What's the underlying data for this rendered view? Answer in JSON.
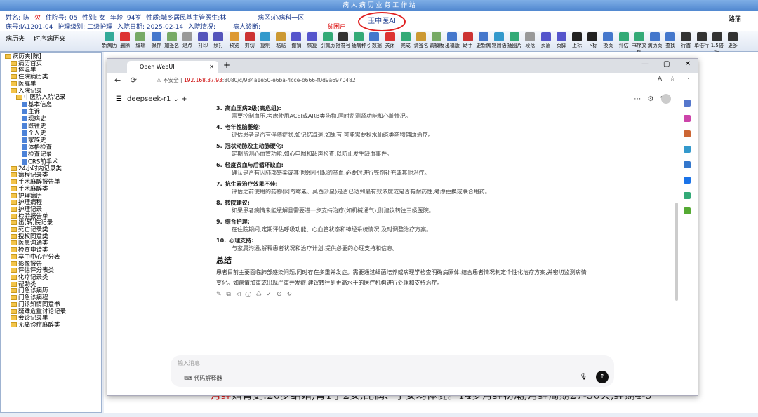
{
  "app": {
    "title": "病 人 病 历 业 务 工 作 站"
  },
  "patient": {
    "name_label": "姓名:",
    "name": "陈",
    "arrears": "欠",
    "inpatient_label": "住院号:",
    "inpatient_no": "05",
    "sex": "性别: 女",
    "age": "年龄: 94岁",
    "nature": "性质:城乡居民基主管医生:林",
    "ward": "病区:心病科一区",
    "bed": "床号:iA1201-04",
    "nursing": "护理级别: 二级护理",
    "admit_date": "入院日期: 2025-02-14",
    "admit_status": "入院情况:",
    "diagnosis": "病人诊断:",
    "poor_tag": "贫困户",
    "ai_button": "玉中医AI",
    "logo": "路蒲"
  },
  "left_tabs": [
    {
      "label": "病历夹"
    },
    {
      "label": "时序病历夹"
    }
  ],
  "toolbar": [
    {
      "label": "新病历",
      "color": "#3a9"
    },
    {
      "label": "删除",
      "color": "#d33"
    },
    {
      "label": "编辑",
      "color": "#7a6"
    },
    {
      "label": "保存",
      "color": "#47c"
    },
    {
      "label": "加签名",
      "color": "#7a6"
    },
    {
      "label": "退点",
      "color": "#999"
    },
    {
      "label": "打印",
      "color": "#55b"
    },
    {
      "label": "续打",
      "color": "#55b"
    },
    {
      "label": "预览",
      "color": "#d93"
    },
    {
      "label": "剪切",
      "color": "#c33"
    },
    {
      "label": "复制",
      "color": "#39c"
    },
    {
      "label": "粘贴",
      "color": "#c93"
    },
    {
      "label": "撤销",
      "color": "#55c"
    },
    {
      "label": "恢复",
      "color": "#55c"
    },
    {
      "label": "引病历",
      "color": "#3a7"
    },
    {
      "label": "插符号",
      "color": "#333"
    },
    {
      "label": "插病种",
      "color": "#3a7"
    },
    {
      "label": "引数据",
      "color": "#47c"
    },
    {
      "label": "关闭",
      "color": "#d33"
    },
    {
      "label": "完成",
      "color": "#3a7"
    },
    {
      "label": "请签名",
      "color": "#c93"
    },
    {
      "label": "调模版",
      "color": "#7a6"
    },
    {
      "label": "出模版",
      "color": "#47c"
    },
    {
      "label": "助手",
      "color": "#c33"
    },
    {
      "label": "更新病",
      "color": "#47c"
    },
    {
      "label": "常用语",
      "color": "#39c"
    },
    {
      "label": "插图片",
      "color": "#3a7"
    },
    {
      "label": "段落",
      "color": "#999"
    },
    {
      "label": "页眉",
      "color": "#55c"
    },
    {
      "label": "页脚",
      "color": "#55c"
    },
    {
      "label": "上标",
      "color": "#222"
    },
    {
      "label": "下标",
      "color": "#222"
    },
    {
      "label": "换页",
      "color": "#47c"
    },
    {
      "label": "评估",
      "color": "#3a7"
    },
    {
      "label": "书序文档",
      "color": "#3a7"
    },
    {
      "label": "病历页",
      "color": "#47c"
    },
    {
      "label": "查找",
      "color": "#47c"
    },
    {
      "label": "行首",
      "color": "#333"
    },
    {
      "label": "单倍行",
      "color": "#333"
    },
    {
      "label": "1.5倍行",
      "color": "#333"
    },
    {
      "label": "更多",
      "color": "#333"
    }
  ],
  "tree": [
    {
      "label": "病历夹[陈]",
      "type": "folder",
      "depth": 0
    },
    {
      "label": "病历首页",
      "type": "folder",
      "depth": 1
    },
    {
      "label": "体温单",
      "type": "folder",
      "depth": 1
    },
    {
      "label": "住院病历类",
      "type": "folder",
      "depth": 1
    },
    {
      "label": "医嘱单",
      "type": "folder",
      "depth": 1
    },
    {
      "label": "入院记录",
      "type": "folder",
      "depth": 1
    },
    {
      "label": "中医院入院记录",
      "type": "folder",
      "depth": 2
    },
    {
      "label": "基本信息",
      "type": "page",
      "depth": 3
    },
    {
      "label": "主诉",
      "type": "page",
      "depth": 3
    },
    {
      "label": "现病史",
      "type": "page",
      "depth": 3
    },
    {
      "label": "既往史",
      "type": "page",
      "depth": 3
    },
    {
      "label": "个人史",
      "type": "page",
      "depth": 3
    },
    {
      "label": "家族史",
      "type": "page",
      "depth": 3
    },
    {
      "label": "体格检查",
      "type": "page",
      "depth": 3
    },
    {
      "label": "检查记录",
      "type": "page",
      "depth": 3
    },
    {
      "label": "CRS前手术",
      "type": "page",
      "depth": 3
    },
    {
      "label": "24小时内记录类",
      "type": "folder",
      "depth": 1
    },
    {
      "label": "病程记录类",
      "type": "folder",
      "depth": 1
    },
    {
      "label": "手术麻醉报告单",
      "type": "folder",
      "depth": 1
    },
    {
      "label": "手术麻醉类",
      "type": "folder",
      "depth": 1
    },
    {
      "label": "护理病历",
      "type": "folder",
      "depth": 1
    },
    {
      "label": "护理病程",
      "type": "folder",
      "depth": 1
    },
    {
      "label": "护理记录",
      "type": "folder",
      "depth": 1
    },
    {
      "label": "检验报告单",
      "type": "folder",
      "depth": 1
    },
    {
      "label": "出(转)院记录",
      "type": "folder",
      "depth": 1
    },
    {
      "label": "死亡记录类",
      "type": "folder",
      "depth": 1
    },
    {
      "label": "授权同意类",
      "type": "folder",
      "depth": 1
    },
    {
      "label": "医患沟通类",
      "type": "folder",
      "depth": 1
    },
    {
      "label": "检查申请类",
      "type": "folder",
      "depth": 1
    },
    {
      "label": "卒中中心评分表",
      "type": "folder",
      "depth": 1
    },
    {
      "label": "影像报告",
      "type": "folder",
      "depth": 1
    },
    {
      "label": "评估评分表类",
      "type": "folder",
      "depth": 1
    },
    {
      "label": "化疗记录类",
      "type": "folder",
      "depth": 1
    },
    {
      "label": "帮助类",
      "type": "folder",
      "depth": 1
    },
    {
      "label": "门急诊病历",
      "type": "folder",
      "depth": 1
    },
    {
      "label": "门急诊病程",
      "type": "folder",
      "depth": 1
    },
    {
      "label": "门诊知情同意书",
      "type": "folder",
      "depth": 1
    },
    {
      "label": "疑难危重讨论记录",
      "type": "folder",
      "depth": 1
    },
    {
      "label": "会诊记录单",
      "type": "folder",
      "depth": 1
    },
    {
      "label": "无痛诊疗麻醉类",
      "type": "folder",
      "depth": 1
    }
  ],
  "background_text": {
    "red": "月经",
    "rest": "婚育史:20岁结婚,育1子2女,配偶、子女均体健。14岁月经初潮,月经周期27-30天,经期4-5"
  },
  "browser": {
    "tab_title": "Open WebUI",
    "new_tab": "+",
    "win_controls": "— ▢ ✕",
    "insecure": "不安全",
    "url_host": "192.168.37.93",
    "url_rest": ":8080/c/984a1e50-e6ba-4cce-b666-f0d9a6970482",
    "model": "deepseek-r1",
    "input_placeholder": "输入消息",
    "code_interpreter": "代码解释器"
  },
  "answer": {
    "items": [
      {
        "num": "3.",
        "head": "高血压病2级(高危组):",
        "desc": "需要控制血压,考虑使用ACEI或ARB类药物,同时监测肾功能和心脏情况。"
      },
      {
        "num": "4.",
        "head": "老年性脑萎缩:",
        "desc": "评估患者是否有伴随症状,如记忆减退,如果有,可能需要秋水仙碱类药物辅助治疗。"
      },
      {
        "num": "5.",
        "head": "冠状动脉及主动脉硬化:",
        "desc": "定期监测心血管功能,如心电图和超声检查,以防止发生缺血事件。"
      },
      {
        "num": "6.",
        "head": "轻度贫血与后循环缺血:",
        "desc": "确认是否有因肺部感染或其他原因引起的贫血,必要时进行铁剂补充或其他治疗。"
      },
      {
        "num": "7.",
        "head": "抗生素治疗效果不佳:",
        "desc": "评估之前使用的药物(阿奇霉素、莫西沙星)是否已达到最有效浓度或是否有耐药性,考虑更换或联合用药。"
      },
      {
        "num": "8.",
        "head": "转院建议:",
        "desc": "如果患者病情未能缓解且需要进一步支持治疗(如机械通气),则建议转往三级医院。"
      },
      {
        "num": "9.",
        "head": "综合护理:",
        "desc": "在住院期间,定期评估呼吸功能、心血管状态和神经系统情况,及时调整治疗方案。"
      },
      {
        "num": "10.",
        "head": "心理支持:",
        "desc": "与家属沟通,解释患者状况和治疗计划,提供必要的心理支持和信息。"
      }
    ],
    "summary_title": "总结",
    "summary": "患者目前主要面临肺部感染问题,同时存在多重并发症。需要通过细菌培养或病理学检查明确病原体,结合患者情况制定个性化治疗方案,并密切监测病情变化。如病情加重或出现严重并发症,建议转往到更高水平的医疗机构进行处理和支持治疗。"
  }
}
